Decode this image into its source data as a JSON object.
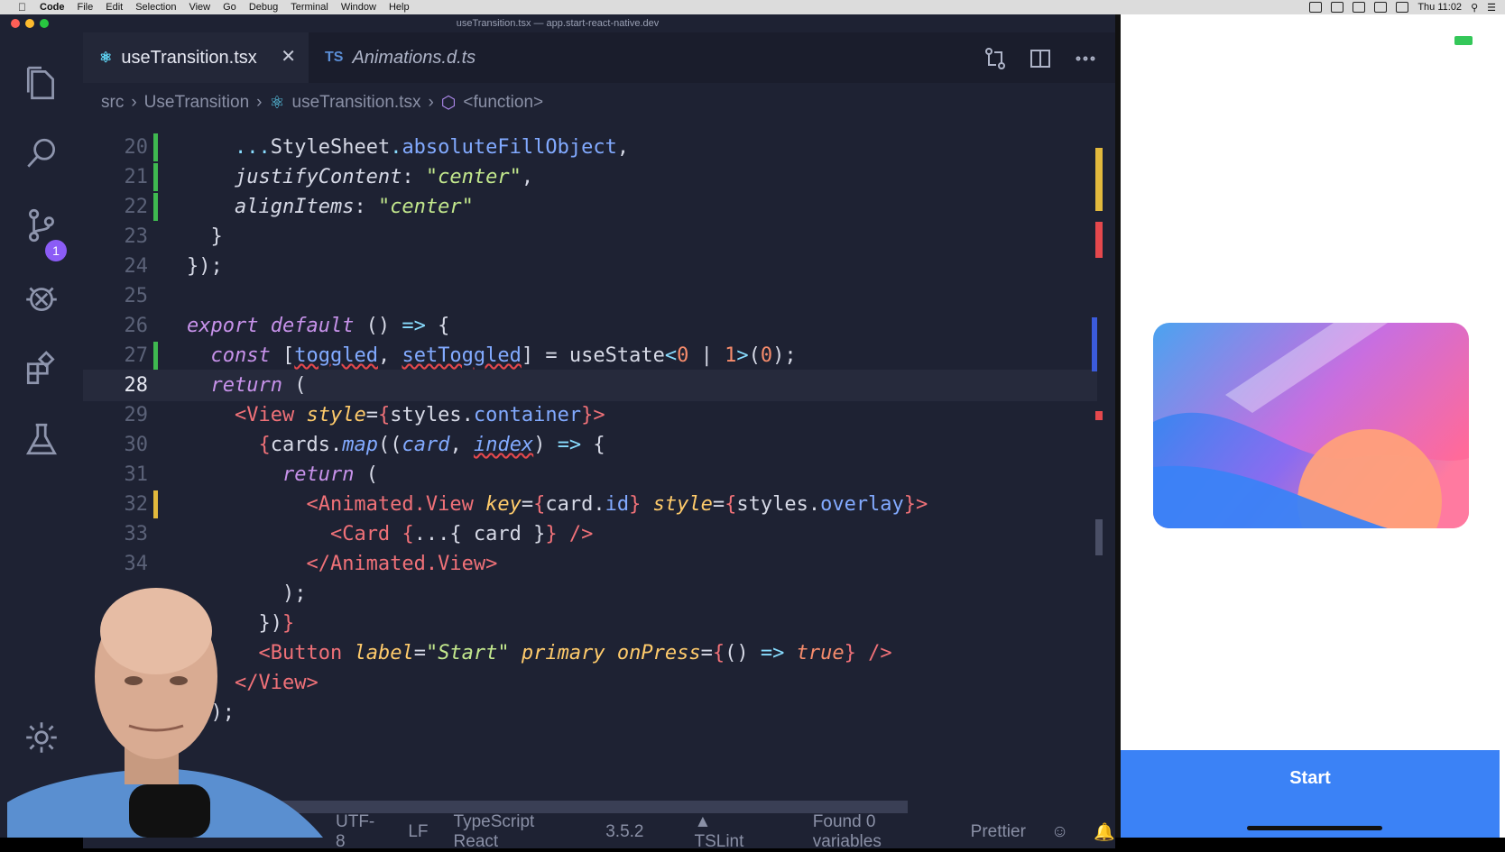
{
  "menubar": {
    "app": "Code",
    "items": [
      "File",
      "Edit",
      "Selection",
      "View",
      "Go",
      "Debug",
      "Terminal",
      "Window",
      "Help"
    ],
    "clock": "Thu 11:02"
  },
  "window": {
    "title": "useTransition.tsx — app.start-react-native.dev"
  },
  "activity": {
    "scm_badge": "1",
    "icons": [
      "files-icon",
      "search-icon",
      "source-control-icon",
      "debug-icon",
      "extensions-icon",
      "test-flask-icon",
      "gear-icon"
    ]
  },
  "tabs": [
    {
      "label": "useTransition.tsx",
      "active": true
    },
    {
      "label": "Animations.d.ts",
      "active": false,
      "prefix": "TS"
    }
  ],
  "breadcrumb": [
    "src",
    "UseTransition",
    "useTransition.tsx",
    "<function>"
  ],
  "code": {
    "lines": [
      {
        "n": "20"
      },
      {
        "n": "21"
      },
      {
        "n": "22"
      },
      {
        "n": "23"
      },
      {
        "n": "24"
      },
      {
        "n": "25"
      },
      {
        "n": "26"
      },
      {
        "n": "27"
      },
      {
        "n": "28"
      },
      {
        "n": "29"
      },
      {
        "n": "30"
      },
      {
        "n": "31"
      },
      {
        "n": "32"
      },
      {
        "n": "33"
      },
      {
        "n": "34"
      }
    ]
  },
  "status": {
    "encoding": "UTF-8",
    "eol": "LF",
    "language": "TypeScript React",
    "version": "3.5.2",
    "lint": "TSLint",
    "vars": "Found 0 variables",
    "formatter": "Prettier"
  },
  "app": {
    "start_label": "Start"
  },
  "colors": {
    "editor_bg": "#1e2233",
    "accent": "#3b82f6",
    "badge": "#8b5cf6"
  }
}
